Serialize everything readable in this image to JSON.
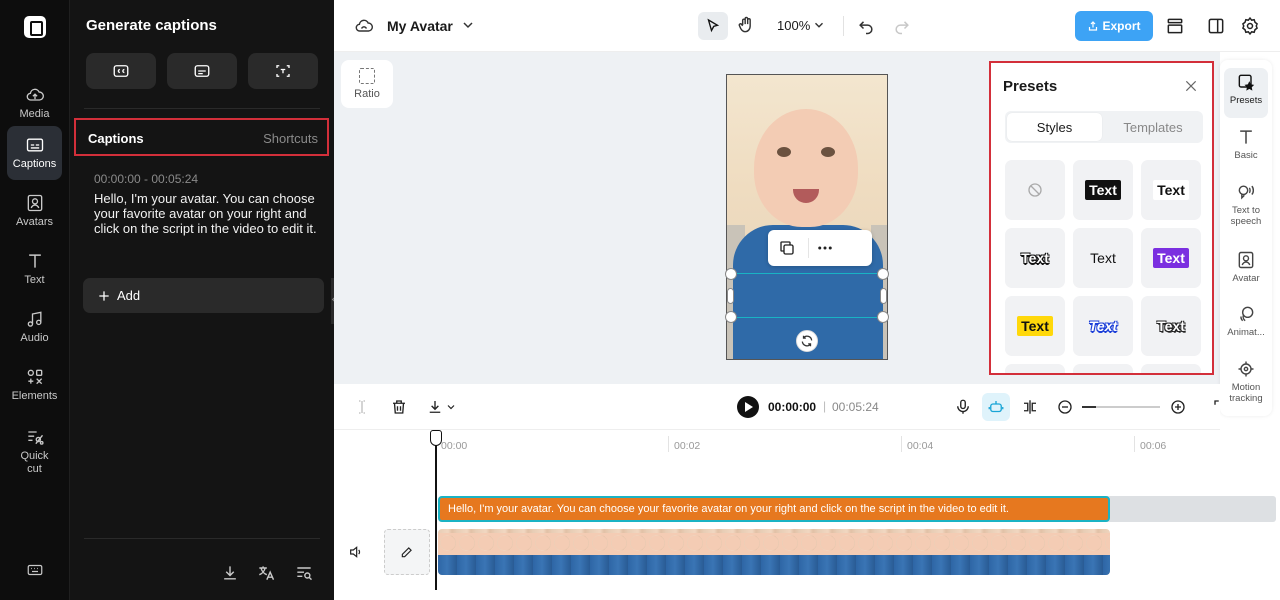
{
  "rail": {
    "items": [
      {
        "label": "Media",
        "icon": "cloud-upload-icon"
      },
      {
        "label": "Captions",
        "icon": "captions-icon",
        "active": true
      },
      {
        "label": "Avatars",
        "icon": "avatar-icon"
      },
      {
        "label": "Text",
        "icon": "text-icon"
      },
      {
        "label": "Audio",
        "icon": "music-note-icon"
      },
      {
        "label": "Elements",
        "icon": "elements-icon"
      },
      {
        "label": "Quick cut",
        "icon": "quick-cut-icon"
      }
    ]
  },
  "panel": {
    "title": "Generate captions",
    "tabs": {
      "captions": "Captions",
      "shortcuts": "Shortcuts"
    },
    "caption": {
      "time": "00:00:00 - 00:05:24",
      "text": "Hello, I'm your avatar. You can choose your favorite avatar on your right and click on the script in the video to edit it."
    },
    "add_label": "Add"
  },
  "topbar": {
    "project_name": "My Avatar",
    "zoom": "100%",
    "export_label": "Export"
  },
  "canvas": {
    "ratio_label": "Ratio"
  },
  "presets": {
    "title": "Presets",
    "tabs": {
      "styles": "Styles",
      "templates": "Templates"
    },
    "tile_text": "Text"
  },
  "right_rail": {
    "items": [
      {
        "label": "Presets",
        "icon": "presets-icon",
        "active": true
      },
      {
        "label": "Basic",
        "icon": "text-icon"
      },
      {
        "label": "Text to speech",
        "icon": "text-to-speech-icon"
      },
      {
        "label": "Avatar",
        "icon": "avatar-icon"
      },
      {
        "label": "Animat...",
        "icon": "animation-icon"
      },
      {
        "label": "Motion tracking",
        "icon": "motion-tracking-icon"
      }
    ]
  },
  "timeline": {
    "current_time": "00:00:00",
    "total_time": "00:05:24",
    "ruler": [
      "00:00",
      "00:02",
      "00:04",
      "00:06"
    ],
    "caption_clip_text": "Hello, I'm your avatar. You can choose your favorite avatar on your right and click on the script in the video to edit it."
  },
  "colors": {
    "accent_export": "#3da3f5",
    "caption_clip": "#e6781f",
    "selection": "#1ab3c4",
    "highlight_border": "#d32f3a"
  }
}
